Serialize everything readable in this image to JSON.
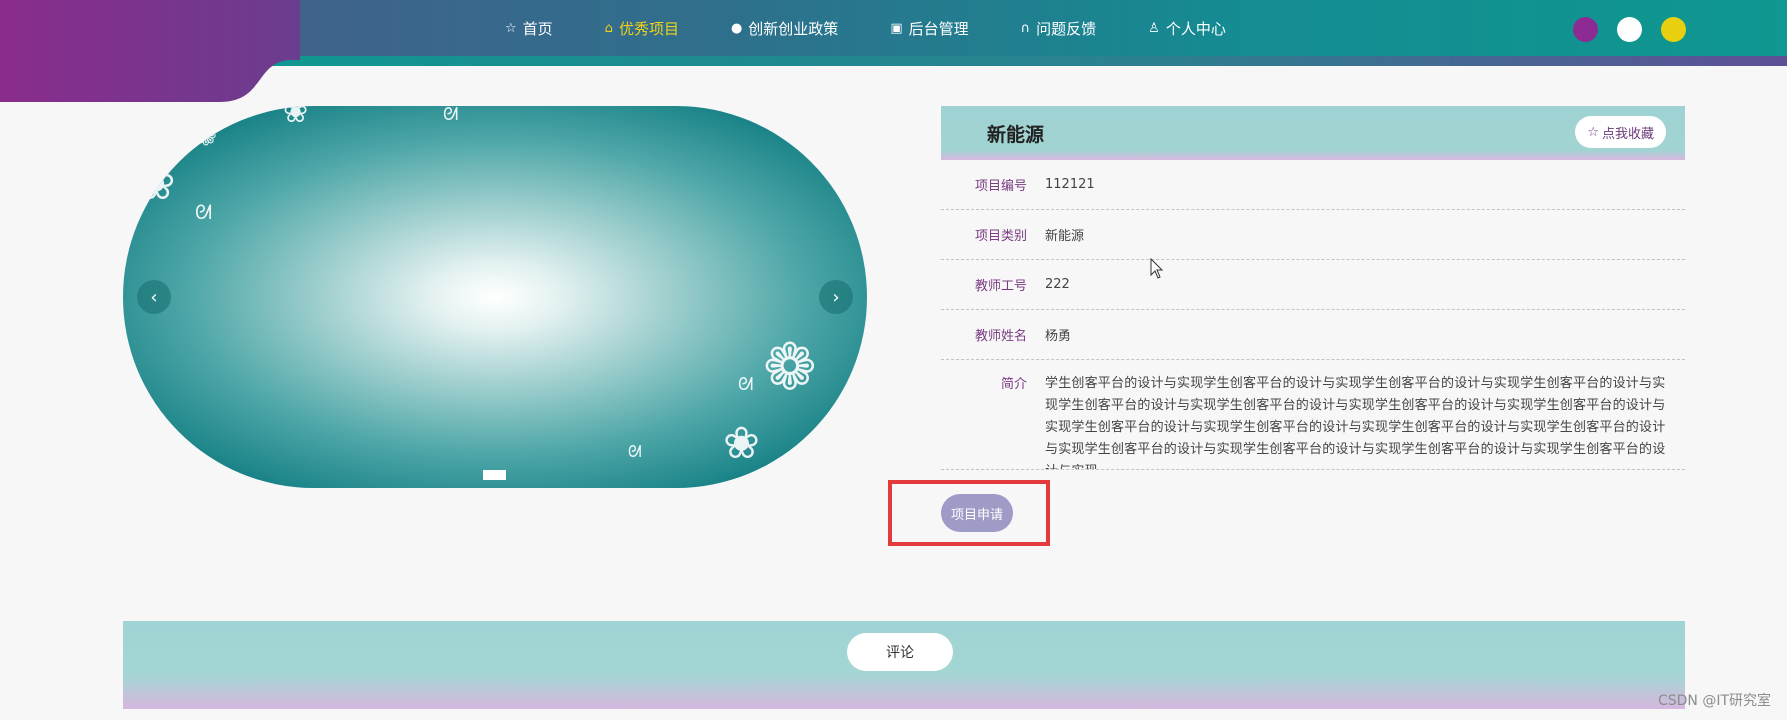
{
  "nav": {
    "items": [
      {
        "label": "首页",
        "icon": "star-icon",
        "active": false
      },
      {
        "label": "优秀项目",
        "icon": "bag-icon",
        "active": true
      },
      {
        "label": "创新创业政策",
        "icon": "info-icon",
        "active": false
      },
      {
        "label": "后台管理",
        "icon": "briefcase-icon",
        "active": false
      },
      {
        "label": "问题反馈",
        "icon": "headset-icon",
        "active": false
      },
      {
        "label": "个人中心",
        "icon": "user-icon",
        "active": false
      }
    ],
    "theme_colors": [
      "#8e2a93",
      "#ffffff",
      "#e8d00f"
    ],
    "active_color": "#f1d21a"
  },
  "carousel": {
    "prev_label": "‹",
    "next_label": "›"
  },
  "detail": {
    "title": "新能源",
    "favorite_label": "点我收藏",
    "fields": [
      {
        "label": "项目编号",
        "value": "112121"
      },
      {
        "label": "项目类别",
        "value": "新能源"
      },
      {
        "label": "教师工号",
        "value": "222"
      },
      {
        "label": "教师姓名",
        "value": "杨勇"
      }
    ],
    "intro_label": "简介",
    "intro_value": "学生创客平台的设计与实现学生创客平台的设计与实现学生创客平台的设计与实现学生创客平台的设计与实现学生创客平台的设计与实现学生创客平台的设计与实现学生创客平台的设计与实现学生创客平台的设计与实现学生创客平台的设计与实现学生创客平台的设计与实现学生创客平台的设计与实现学生创客平台的设计与实现学生创客平台的设计与实现学生创客平台的设计与实现学生创客平台的设计与实现学生创客平台的设计与实现"
  },
  "apply_label": "项目申请",
  "comment_label": "评论",
  "watermark": "CSDN @IT研究室",
  "colors": {
    "accent_purple": "#7a3c82",
    "apply_button": "#9e9cc7",
    "highlight_border": "#e33b3b"
  }
}
